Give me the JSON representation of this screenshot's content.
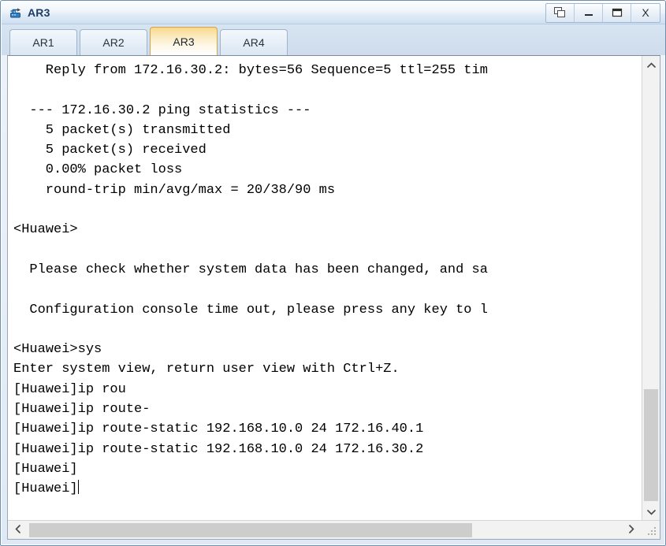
{
  "window": {
    "title": "AR3",
    "icon": "router-icon",
    "controls": [
      {
        "name": "restore-window-button",
        "icon": "restore-icon",
        "label": ""
      },
      {
        "name": "minimize-window-button",
        "icon": "minimize-icon",
        "label": "_"
      },
      {
        "name": "maximize-window-button",
        "icon": "maximize-icon",
        "label": ""
      },
      {
        "name": "close-window-button",
        "icon": "close-icon",
        "label": "X"
      }
    ]
  },
  "tabs": [
    {
      "label": "AR1",
      "active": false
    },
    {
      "label": "AR2",
      "active": false
    },
    {
      "label": "AR3",
      "active": true
    },
    {
      "label": "AR4",
      "active": false
    }
  ],
  "console": {
    "lines": [
      "    Reply from 172.16.30.2: bytes=56 Sequence=5 ttl=255 tim",
      "",
      "  --- 172.16.30.2 ping statistics ---",
      "    5 packet(s) transmitted",
      "    5 packet(s) received",
      "    0.00% packet loss",
      "    round-trip min/avg/max = 20/38/90 ms",
      "",
      "<Huawei>",
      "",
      "  Please check whether system data has been changed, and sa",
      "",
      "  Configuration console time out, please press any key to l",
      "",
      "<Huawei>sys",
      "Enter system view, return user view with Ctrl+Z.",
      "[Huawei]ip rou",
      "[Huawei]ip route-",
      "[Huawei]ip route-static 192.168.10.0 24 172.16.40.1",
      "[Huawei]ip route-static 192.168.10.0 24 172.16.30.2",
      "[Huawei]"
    ],
    "prompt_line": "[Huawei]"
  },
  "scrollbars": {
    "vertical": {
      "up_arrow": "chevron-up-icon",
      "down_arrow": "chevron-down-icon",
      "thumb_top_pct": 72,
      "thumb_height_pct": 24
    },
    "horizontal": {
      "left_arrow": "chevron-left-icon",
      "right_arrow": "chevron-right-icon",
      "thumb_left_pct": 3,
      "thumb_width_pct": 70
    },
    "resize_grip": "resize-grip-icon"
  },
  "colors": {
    "title_bar_top": "#fbfdfe",
    "title_bar_bottom": "#cfe0f1",
    "active_tab_gold": "#f8d88c",
    "active_tab_border": "#d2a44c",
    "window_border": "#6f8cad",
    "console_bg": "#ffffff",
    "console_text": "#000000",
    "scrollbar_thumb": "#cdcdcd"
  }
}
